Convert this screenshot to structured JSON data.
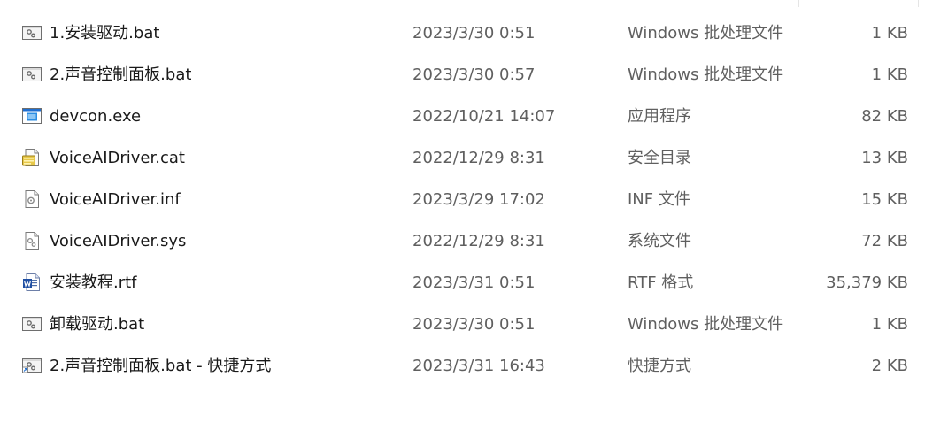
{
  "files": [
    {
      "name": "1.安装驱动.bat",
      "date": "2023/3/30 0:51",
      "type": "Windows 批处理文件",
      "size": "1 KB",
      "icon": "batch-file-icon"
    },
    {
      "name": "2.声音控制面板.bat",
      "date": "2023/3/30 0:57",
      "type": "Windows 批处理文件",
      "size": "1 KB",
      "icon": "batch-file-icon"
    },
    {
      "name": "devcon.exe",
      "date": "2022/10/21 14:07",
      "type": "应用程序",
      "size": "82 KB",
      "icon": "exe-file-icon"
    },
    {
      "name": "VoiceAIDriver.cat",
      "date": "2022/12/29 8:31",
      "type": "安全目录",
      "size": "13 KB",
      "icon": "catalog-file-icon"
    },
    {
      "name": "VoiceAIDriver.inf",
      "date": "2023/3/29 17:02",
      "type": "INF 文件",
      "size": "15 KB",
      "icon": "inf-file-icon"
    },
    {
      "name": "VoiceAIDriver.sys",
      "date": "2022/12/29 8:31",
      "type": "系统文件",
      "size": "72 KB",
      "icon": "sys-file-icon"
    },
    {
      "name": "安装教程.rtf",
      "date": "2023/3/31 0:51",
      "type": "RTF 格式",
      "size": "35,379 KB",
      "icon": "word-document-icon"
    },
    {
      "name": "卸载驱动.bat",
      "date": "2023/3/30 0:51",
      "type": "Windows 批处理文件",
      "size": "1 KB",
      "icon": "batch-file-icon"
    },
    {
      "name": "2.声音控制面板.bat - 快捷方式",
      "date": "2023/3/31 16:43",
      "type": "快捷方式",
      "size": "2 KB",
      "icon": "shortcut-batch-icon"
    }
  ]
}
